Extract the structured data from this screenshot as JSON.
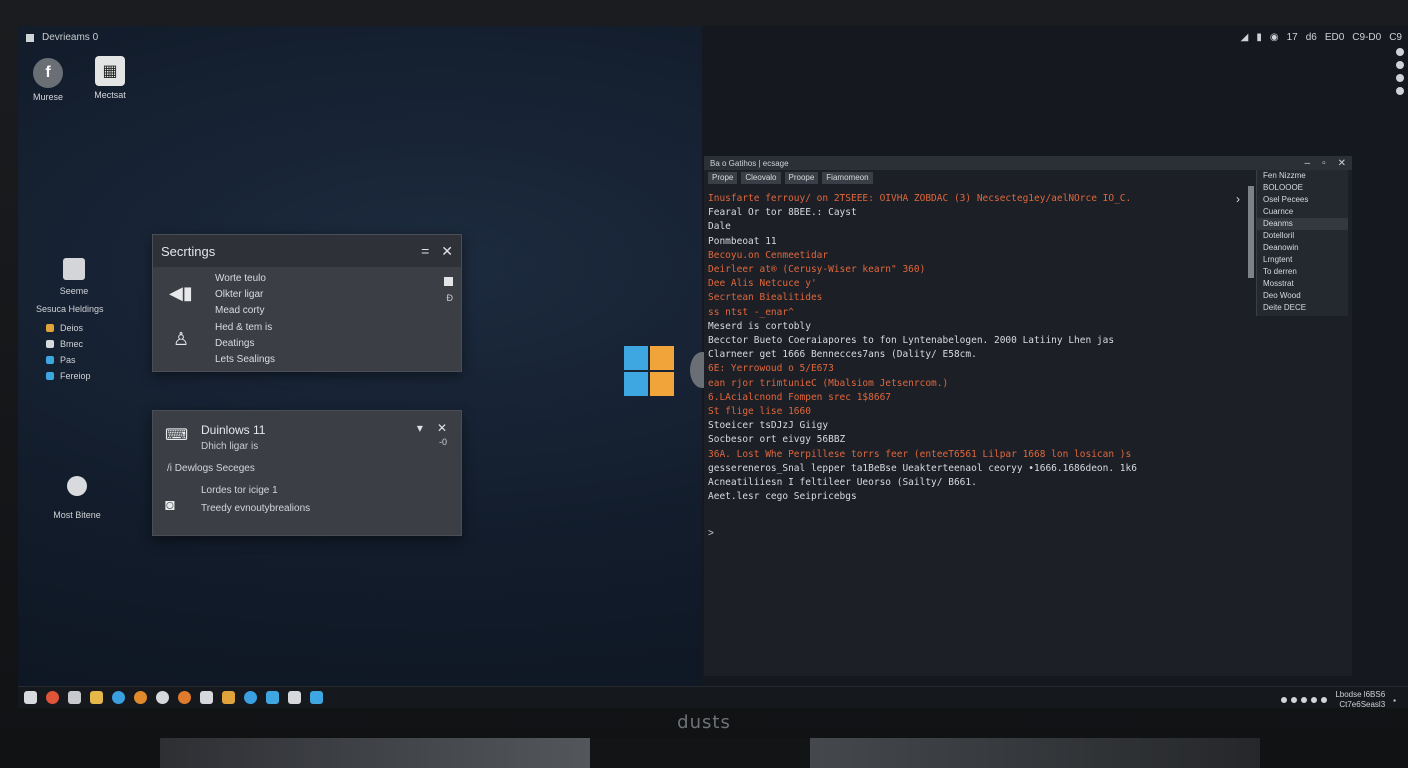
{
  "topbar": {
    "title": "Devrieams 0",
    "status": [
      "17",
      "d6",
      "ED0",
      "C9-D0",
      "C9"
    ]
  },
  "desktop_icons": [
    {
      "label": "Murese",
      "icon": "facebook-icon",
      "glyph": "f"
    },
    {
      "label": "Mectsat",
      "icon": "calculator-icon",
      "glyph": "▦"
    }
  ],
  "sidebar": {
    "header": "Seeme",
    "subtitle": "Sesuca Heldings",
    "items": [
      {
        "label": "Deios",
        "color": "#e0a33b"
      },
      {
        "label": "Bmec",
        "color": "#d8dade"
      },
      {
        "label": "Pas",
        "color": "#3ea6e0"
      },
      {
        "label": "Fereiop",
        "color": "#3ea6e0"
      }
    ]
  },
  "msg_icon": {
    "label": "Most Bitene"
  },
  "settings_panel": {
    "title": "Secrtings",
    "lines": [
      "Worte teulo",
      "Olkter ligar",
      "Mead corty",
      "Hed & tem is",
      "Deatings",
      "Lets Sealings"
    ],
    "check2": "Ð"
  },
  "windows_panel": {
    "title": "Duinlows 11",
    "subtitle": "Dhich ligar is",
    "line3": "Dewlogs Seceges",
    "line4": "Lordes tor icige 1",
    "line5": "Treedy evnoutybrealions",
    "ctl_sub": "-0"
  },
  "terminal": {
    "title": "Ba o Gatihos | ecsage",
    "tabs": [
      "Prope",
      "Cleovalo",
      "Proope",
      "Fiamomeon"
    ],
    "menu": [
      "Fen Nizzme",
      "BOLOOOE",
      "Osel Pecees",
      "Cuarnce",
      "Deanms",
      "Dotelloril",
      "Deanowin",
      "Lrngtent",
      "To derren",
      "Mosstrat",
      "Deo Wood",
      "Deite DECE"
    ],
    "lines": [
      {
        "text": "Inusfarte ferrouy/ on 2TSEEE: OIVHA ZOBDAC (3) Necsecteg1ey/aelNOrce IO_C.",
        "orange": true
      },
      {
        "text": "Fearal Or tor 8BEE.: Cayst",
        "orange": false
      },
      {
        "text": "Dale",
        "orange": false
      },
      {
        "text": "Ponmbeoat 11",
        "orange": false
      },
      {
        "text": "Becoyu.on Cenmeetidar",
        "orange": true
      },
      {
        "text": "Deirleer at® (Cerusy-Wiser kearn\" 360)",
        "orange": true
      },
      {
        "text": "Dee Alis Netcuce y'",
        "orange": true
      },
      {
        "text": "Secrtean Biealitides",
        "orange": true
      },
      {
        "text": "ss ntst -_enar^",
        "orange": true
      },
      {
        "text": "Meserd is cortobly",
        "orange": false
      },
      {
        "text": "Becctor Bueto Coeraiapores to fon Lyntenabelogen. 2000 Latiiny Lhen jas",
        "orange": false
      },
      {
        "text": "Clarneer get 1666 Bennecces7ans (Dality/ E58cm.",
        "orange": false
      },
      {
        "text": "6E: Yerrowoud o 5/E673",
        "orange": true
      },
      {
        "text": "ean rjor trimtunieC (Mbalsiom Jetsenrcom.)",
        "orange": true
      },
      {
        "text": "6.LAcialcnond Fompen srec 1$8667",
        "orange": true
      },
      {
        "text": "St flige lise 1660",
        "orange": true
      },
      {
        "text": "Stoeicer tsDJzJ Giigy",
        "orange": false
      },
      {
        "text": "Socbesor ort eivgy 56BBZ",
        "orange": false
      },
      {
        "text": "36A. Lost Whe Perpillese torrs feer (enteeT6561 Lilpar 1668 lon losican )s",
        "orange": true
      },
      {
        "text": "gessereneros_Snal lepper ta1BeBse Ueakterteenaol ceoryy •1666.1686deon. 1k6",
        "orange": false
      },
      {
        "text": "Acneatiliiesn I feltileer Ueorso (Sailty/ B661.",
        "orange": false
      },
      {
        "text": "Aeet.lesr cego Seipricebgs",
        "orange": false
      }
    ],
    "caret": ">"
  },
  "taskbar": {
    "icons": [
      {
        "name": "square-icon",
        "color": "#d8dadd"
      },
      {
        "name": "record-icon",
        "color": "#e0553a"
      },
      {
        "name": "calendar-icon",
        "color": "#c7c9cc"
      },
      {
        "name": "folder-icon",
        "color": "#e6b84a"
      },
      {
        "name": "telegram-icon",
        "color": "#3aa0e0"
      },
      {
        "name": "firefox-icon",
        "color": "#e08a2c"
      },
      {
        "name": "chrome-icon",
        "color": "#d6d8db"
      },
      {
        "name": "firefox-alt-icon",
        "color": "#e07a2c"
      },
      {
        "name": "mail-icon",
        "color": "#d6d8db"
      },
      {
        "name": "chat-icon",
        "color": "#e0a33b"
      },
      {
        "name": "edge-icon",
        "color": "#3aa0e0"
      },
      {
        "name": "windows-icon",
        "color": "#3ea6e0"
      },
      {
        "name": "bag-icon",
        "color": "#d6d8db"
      },
      {
        "name": "store-icon",
        "color": "#3ea6e0"
      }
    ],
    "clock_line1": "Lbodse l6BS6",
    "clock_line2": "Ct7e6Seasl3"
  },
  "brand": "dusts",
  "colors": {
    "accent_orange": "#e0663c",
    "win_blue": "#3ea6e0",
    "win_orange": "#f0a43a"
  }
}
